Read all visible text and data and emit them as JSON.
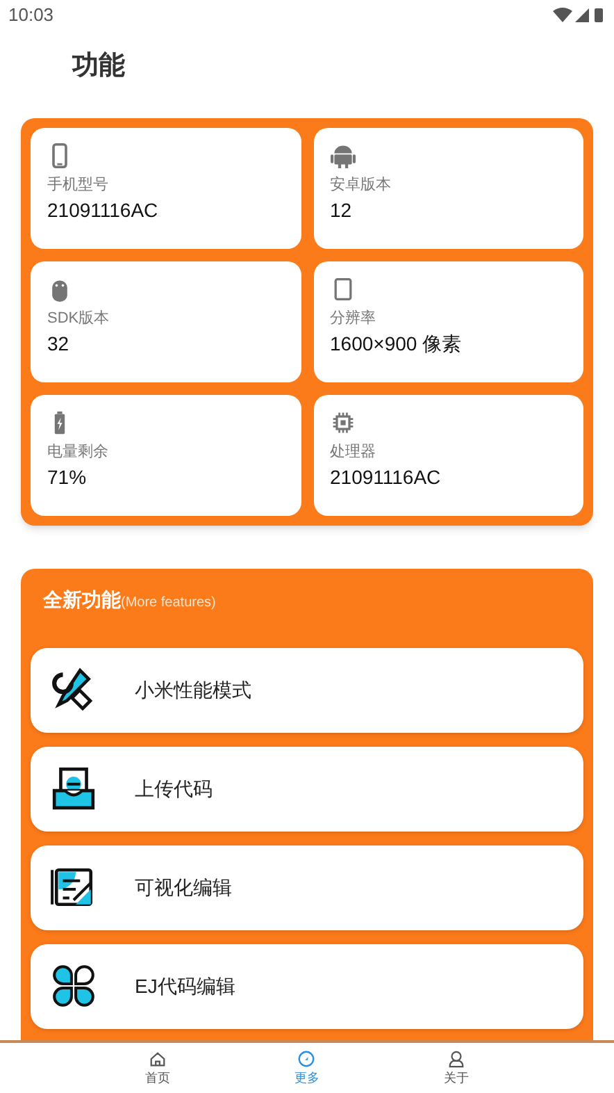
{
  "status_bar": {
    "time": "10:03"
  },
  "page_title": "功能",
  "device_info": [
    {
      "kind": "phone",
      "label": "手机型号",
      "value": "21091116AC"
    },
    {
      "kind": "android",
      "label": "安卓版本",
      "value": "12"
    },
    {
      "kind": "sdk",
      "label": "SDK版本",
      "value": "32"
    },
    {
      "kind": "screen",
      "label": "分辨率",
      "value": "1600×900 像素"
    },
    {
      "kind": "battery",
      "label": "电量剩余",
      "value": "71%"
    },
    {
      "kind": "chip",
      "label": "处理器",
      "value": "21091116AC"
    }
  ],
  "features": {
    "title": "全新功能",
    "subtitle": "(More features)",
    "items": [
      {
        "kind": "tools",
        "label": "小米性能模式"
      },
      {
        "kind": "upload",
        "label": "上传代码"
      },
      {
        "kind": "edit",
        "label": "可视化编辑"
      },
      {
        "kind": "grid",
        "label": "EJ代码编辑"
      }
    ]
  },
  "bottom_nav": [
    {
      "kind": "home",
      "label": "首页",
      "selected": false
    },
    {
      "kind": "compass",
      "label": "更多",
      "selected": true
    },
    {
      "kind": "person",
      "label": "关于",
      "selected": false
    }
  ]
}
